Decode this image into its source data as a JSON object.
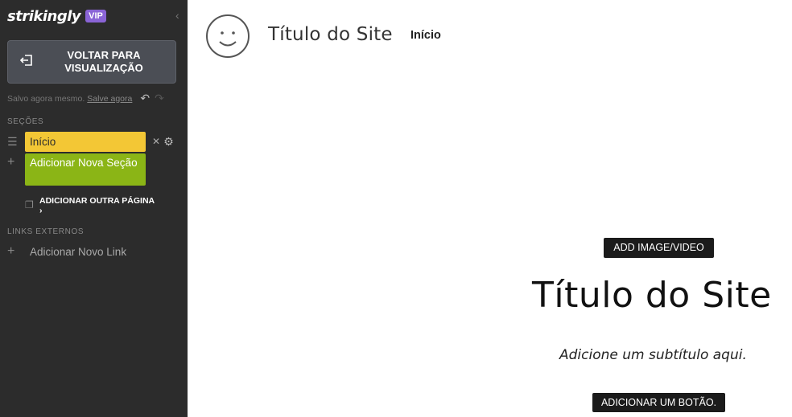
{
  "sidebar": {
    "logo": "strikingly",
    "badge": "VIP",
    "collapse_icon": "chevron-left-icon",
    "back_button": {
      "label": "VOLTAR PARA VISUALIZAÇÃO",
      "icon": "exit-icon"
    },
    "save_status": {
      "text": "Salvo agora mesmo.",
      "link": "Salve agora"
    },
    "sections_header": "SEÇÕES",
    "sections": [
      {
        "label": "Início"
      }
    ],
    "add_section": "Adicionar Nova Seção",
    "add_page": "ADICIONAR OUTRA PÁGINA",
    "external_links_header": "LINKS EXTERNOS",
    "add_link": "Adicionar Novo Link"
  },
  "header": {
    "site_title": "Título do Site",
    "nav": [
      {
        "label": "Início"
      }
    ]
  },
  "hero": {
    "media_button": "ADD IMAGE/VIDEO",
    "title": "Título do Site",
    "subtitle": "Adicione um subtítulo aqui.",
    "cta_button": "ADICIONAR UM BOTÃO."
  },
  "colors": {
    "sidebar_bg": "#2c2c2c",
    "section_active": "#f3c735",
    "add_section": "#8bb516",
    "vip_badge": "#8a64d6"
  }
}
